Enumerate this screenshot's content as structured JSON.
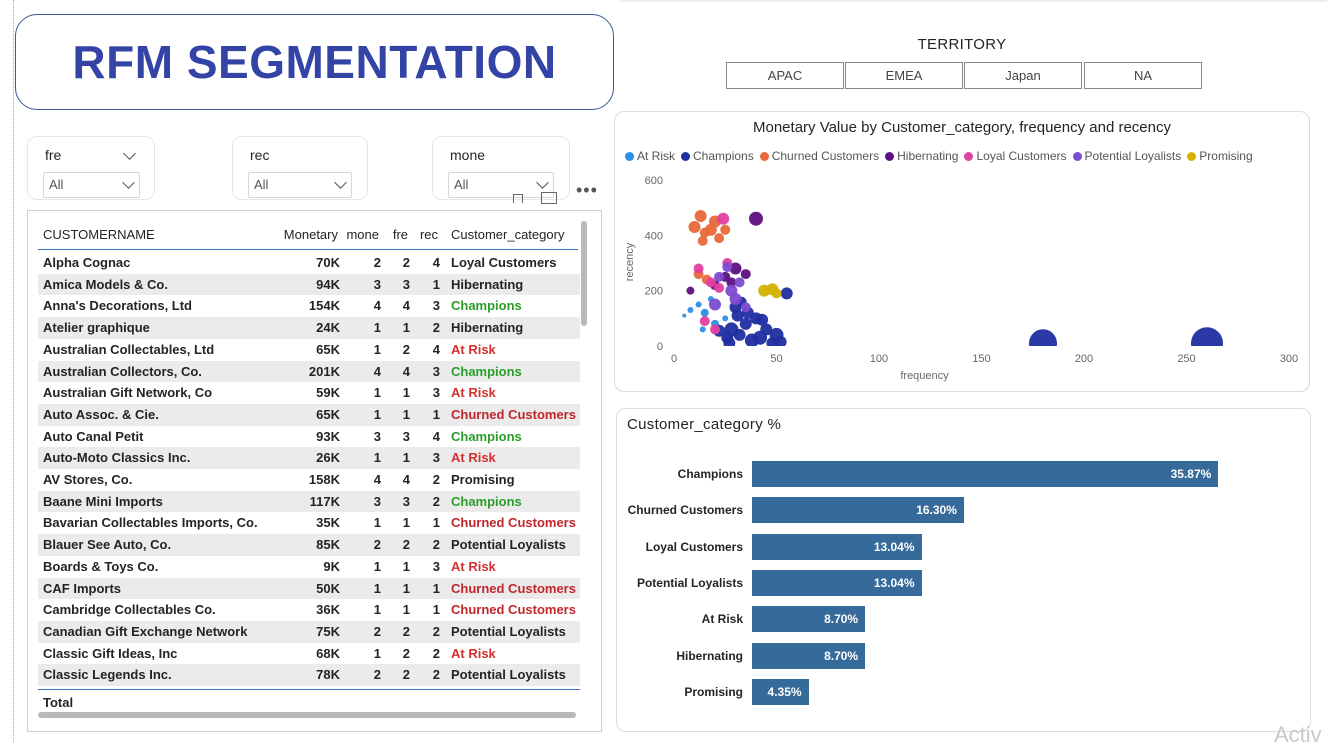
{
  "title": "RFM SEGMENTATION",
  "colors": {
    "accent": "#3344a6",
    "bar": "#356a9a",
    "champions": "#2a9d2a",
    "risk": "#d33030",
    "churned": "#c0272d"
  },
  "slicers": [
    {
      "label": "fre",
      "value": "All"
    },
    {
      "label": "rec",
      "value": "All"
    },
    {
      "label": "mone",
      "value": "All"
    }
  ],
  "table": {
    "headers": {
      "name": "CUSTOMERNAME",
      "monetary": "Monetary",
      "mone": "mone",
      "fre": "fre",
      "rec": "rec",
      "category": "Customer_category"
    },
    "rows": [
      {
        "name": "Alpha Cognac",
        "monetary": "70K",
        "mone": "2",
        "fre": "2",
        "rec": "4",
        "category": "Loyal Customers"
      },
      {
        "name": "Amica Models & Co.",
        "monetary": "94K",
        "mone": "3",
        "fre": "3",
        "rec": "1",
        "category": "Hibernating"
      },
      {
        "name": "Anna's Decorations, Ltd",
        "monetary": "154K",
        "mone": "4",
        "fre": "4",
        "rec": "3",
        "category": "Champions"
      },
      {
        "name": "Atelier graphique",
        "monetary": "24K",
        "mone": "1",
        "fre": "1",
        "rec": "2",
        "category": "Hibernating"
      },
      {
        "name": "Australian Collectables, Ltd",
        "monetary": "65K",
        "mone": "1",
        "fre": "2",
        "rec": "4",
        "category": "At Risk"
      },
      {
        "name": "Australian Collectors, Co.",
        "monetary": "201K",
        "mone": "4",
        "fre": "4",
        "rec": "3",
        "category": "Champions"
      },
      {
        "name": "Australian Gift Network, Co",
        "monetary": "59K",
        "mone": "1",
        "fre": "1",
        "rec": "3",
        "category": "At Risk"
      },
      {
        "name": "Auto Assoc. & Cie.",
        "monetary": "65K",
        "mone": "1",
        "fre": "1",
        "rec": "1",
        "category": "Churned Customers"
      },
      {
        "name": "Auto Canal Petit",
        "monetary": "93K",
        "mone": "3",
        "fre": "3",
        "rec": "4",
        "category": "Champions"
      },
      {
        "name": "Auto-Moto Classics Inc.",
        "monetary": "26K",
        "mone": "1",
        "fre": "1",
        "rec": "3",
        "category": "At Risk"
      },
      {
        "name": "AV Stores, Co.",
        "monetary": "158K",
        "mone": "4",
        "fre": "4",
        "rec": "2",
        "category": "Promising"
      },
      {
        "name": "Baane Mini Imports",
        "monetary": "117K",
        "mone": "3",
        "fre": "3",
        "rec": "2",
        "category": "Champions"
      },
      {
        "name": "Bavarian Collectables Imports, Co.",
        "monetary": "35K",
        "mone": "1",
        "fre": "1",
        "rec": "1",
        "category": "Churned Customers"
      },
      {
        "name": "Blauer See Auto, Co.",
        "monetary": "85K",
        "mone": "2",
        "fre": "2",
        "rec": "2",
        "category": "Potential Loyalists"
      },
      {
        "name": "Boards & Toys Co.",
        "monetary": "9K",
        "mone": "1",
        "fre": "1",
        "rec": "3",
        "category": "At Risk"
      },
      {
        "name": "CAF Imports",
        "monetary": "50K",
        "mone": "1",
        "fre": "1",
        "rec": "1",
        "category": "Churned Customers"
      },
      {
        "name": "Cambridge Collectables Co.",
        "monetary": "36K",
        "mone": "1",
        "fre": "1",
        "rec": "1",
        "category": "Churned Customers"
      },
      {
        "name": "Canadian Gift Exchange Network",
        "monetary": "75K",
        "mone": "2",
        "fre": "2",
        "rec": "2",
        "category": "Potential Loyalists"
      },
      {
        "name": "Classic Gift Ideas, Inc",
        "monetary": "68K",
        "mone": "1",
        "fre": "2",
        "rec": "2",
        "category": "At Risk"
      },
      {
        "name": "Classic Legends Inc.",
        "monetary": "78K",
        "mone": "2",
        "fre": "2",
        "rec": "2",
        "category": "Potential Loyalists"
      }
    ],
    "total_label": "Total"
  },
  "territory": {
    "title": "TERRITORY",
    "options": [
      "APAC",
      "EMEA",
      "Japan",
      "NA"
    ]
  },
  "chart_data": [
    {
      "type": "scatter",
      "title": "Monetary Value by Customer_category, frequency and recency",
      "xlabel": "frequency",
      "ylabel": "recency",
      "xlim": [
        0,
        300
      ],
      "ylim": [
        0,
        600
      ],
      "xticks": [
        "0",
        "50",
        "100",
        "150",
        "200",
        "250",
        "300"
      ],
      "yticks": [
        "0",
        "200",
        "400",
        "600"
      ],
      "legend_position": "top",
      "series": [
        {
          "name": "At Risk",
          "color": "#2b8fe6",
          "points": [
            [
              5,
              110,
              2
            ],
            [
              8,
              130,
              3
            ],
            [
              12,
              150,
              3
            ],
            [
              15,
              120,
              4
            ],
            [
              18,
              170,
              3
            ],
            [
              20,
              80,
              4
            ],
            [
              25,
              100,
              3
            ],
            [
              14,
              60,
              3
            ]
          ]
        },
        {
          "name": "Champions",
          "color": "#1f2ea0",
          "points": [
            [
              28,
              60,
              7
            ],
            [
              32,
              40,
              6
            ],
            [
              35,
              80,
              6
            ],
            [
              38,
              20,
              7
            ],
            [
              40,
              100,
              6
            ],
            [
              42,
              30,
              7
            ],
            [
              45,
              60,
              6
            ],
            [
              48,
              10,
              6
            ],
            [
              50,
              40,
              7
            ],
            [
              52,
              15,
              6
            ],
            [
              55,
              190,
              6
            ],
            [
              30,
              140,
              6
            ],
            [
              33,
              160,
              5
            ],
            [
              36,
              120,
              6
            ],
            [
              26,
              30,
              6
            ],
            [
              22,
              55,
              6
            ],
            [
              27,
              10,
              6
            ],
            [
              31,
              110,
              6
            ],
            [
              43,
              95,
              6
            ],
            [
              180,
              10,
              14
            ],
            [
              260,
              10,
              16
            ]
          ]
        },
        {
          "name": "Churned Customers",
          "color": "#e8683a",
          "points": [
            [
              10,
              430,
              6
            ],
            [
              13,
              470,
              6
            ],
            [
              15,
              410,
              5
            ],
            [
              18,
              420,
              6
            ],
            [
              20,
              450,
              6
            ],
            [
              22,
              390,
              5
            ],
            [
              25,
              420,
              5
            ],
            [
              14,
              380,
              5
            ],
            [
              12,
              260,
              5
            ],
            [
              16,
              240,
              5
            ]
          ]
        },
        {
          "name": "Hibernating",
          "color": "#5e1080",
          "points": [
            [
              40,
              460,
              7
            ],
            [
              30,
              280,
              6
            ],
            [
              35,
              260,
              5
            ],
            [
              25,
              250,
              5
            ],
            [
              20,
              220,
              5
            ],
            [
              8,
              200,
              4
            ],
            [
              28,
              230,
              5
            ]
          ]
        },
        {
          "name": "Loyal Customers",
          "color": "#e040a0",
          "points": [
            [
              12,
              280,
              5
            ],
            [
              18,
              230,
              5
            ],
            [
              22,
              210,
              5
            ],
            [
              26,
              300,
              5
            ],
            [
              15,
              90,
              5
            ],
            [
              20,
              60,
              5
            ],
            [
              24,
              460,
              6
            ]
          ]
        },
        {
          "name": "Potential Loyalists",
          "color": "#7c4bd0",
          "points": [
            [
              20,
              150,
              6
            ],
            [
              28,
              200,
              6
            ],
            [
              30,
              170,
              6
            ],
            [
              35,
              140,
              5
            ],
            [
              22,
              250,
              5
            ],
            [
              26,
              285,
              5
            ],
            [
              32,
              230,
              5
            ]
          ]
        },
        {
          "name": "Promising",
          "color": "#d4b200",
          "points": [
            [
              44,
              200,
              6
            ],
            [
              48,
              205,
              6
            ],
            [
              50,
              190,
              5
            ]
          ]
        }
      ]
    },
    {
      "type": "bar",
      "title": "Customer_category %",
      "categories": [
        "Champions",
        "Churned Customers",
        "Loyal Customers",
        "Potential Loyalists",
        "At Risk",
        "Hibernating",
        "Promising"
      ],
      "values": [
        35.87,
        16.3,
        13.04,
        13.04,
        8.7,
        8.7,
        4.35
      ],
      "labels": [
        "35.87%",
        "16.30%",
        "13.04%",
        "13.04%",
        "8.70%",
        "8.70%",
        "4.35%"
      ],
      "xlim": [
        0,
        40
      ]
    }
  ],
  "watermark": "Activ"
}
